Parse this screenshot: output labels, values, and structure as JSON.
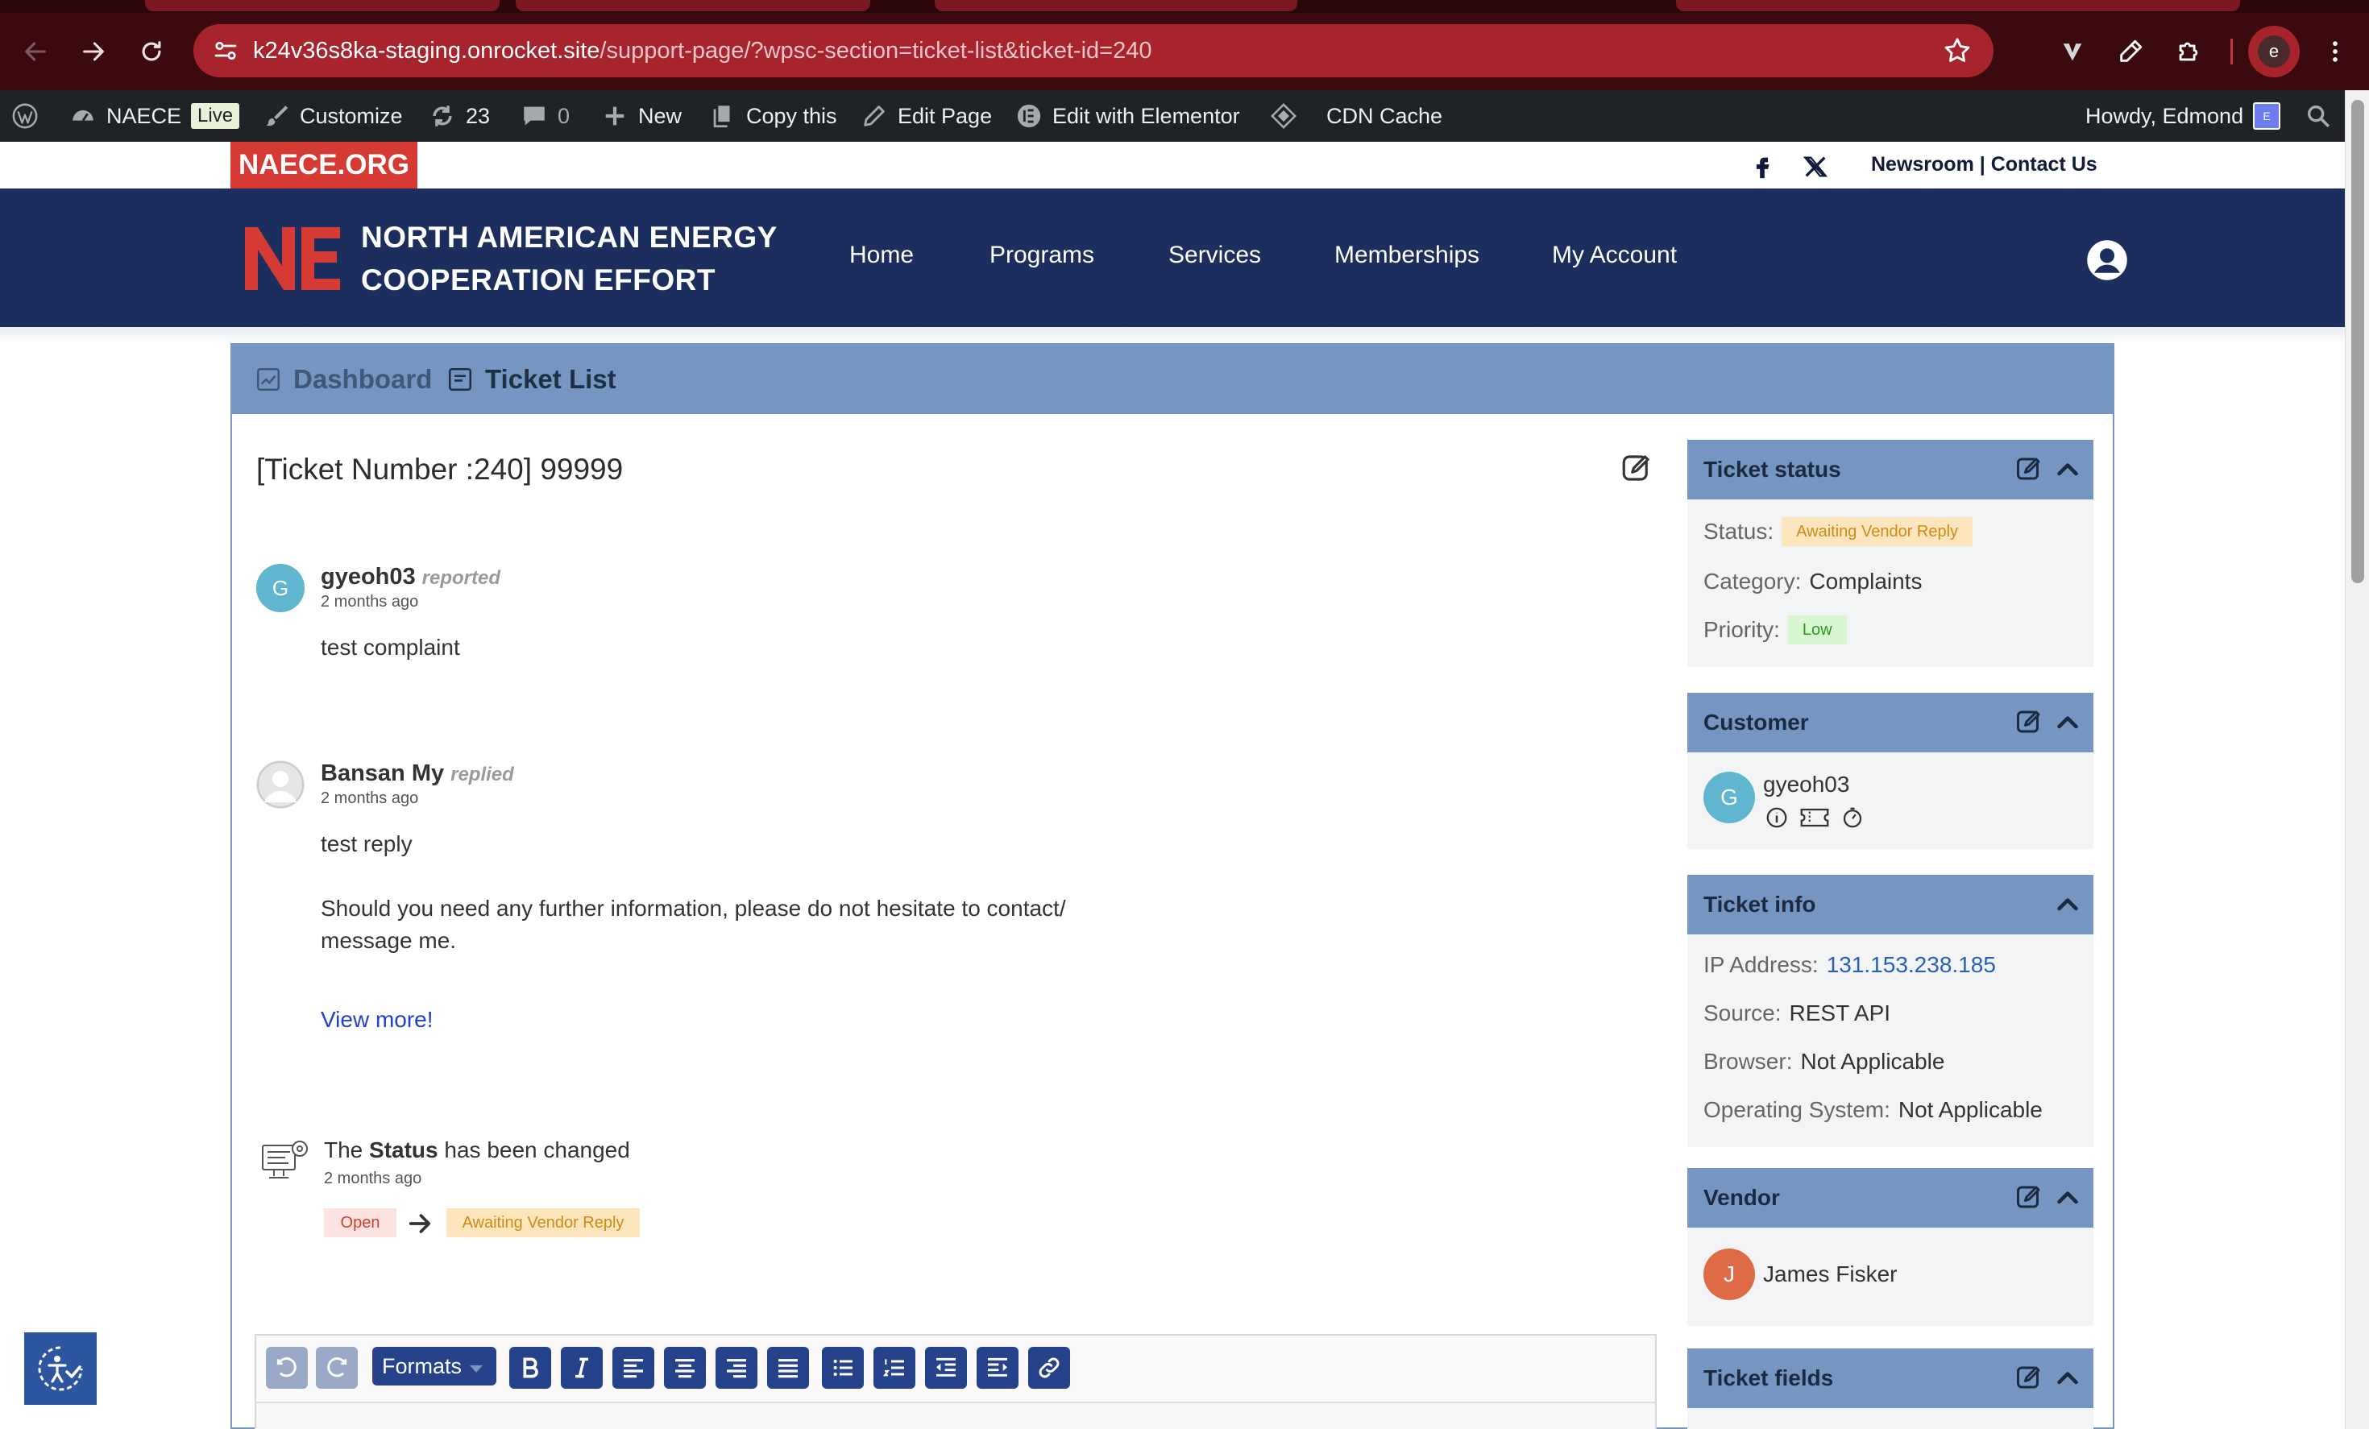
{
  "browser": {
    "url_host": "k24v36s8ka-staging.onrocket.site",
    "url_path": "/support-page/?wpsc-section=ticket-list&ticket-id=240",
    "profile_initial": "e"
  },
  "wp_admin_bar": {
    "site_name": "NAECE",
    "live_badge": "Live",
    "customize": "Customize",
    "updates_count": "23",
    "comments_count": "0",
    "new": "New",
    "copy_this": "Copy this",
    "edit_page": "Edit Page",
    "edit_with_elementor": "Edit with Elementor",
    "cdn_cache": "CDN Cache",
    "howdy": "Howdy, Edmond",
    "avatar_initial": "E"
  },
  "site": {
    "tag": "NAECE.ORG",
    "top_links": "Newsroom | Contact Us",
    "org_name_line1": "NORTH AMERICAN ENERGY",
    "org_name_line2": "COOPERATION EFFORT",
    "nav": [
      "Home",
      "Programs",
      "Services",
      "Memberships",
      "My Account"
    ]
  },
  "support": {
    "tabs": {
      "dashboard": "Dashboard",
      "ticket_list": "Ticket List"
    },
    "ticket_title": "[Ticket Number :240] 99999",
    "threads": [
      {
        "avatar_initial": "G",
        "author": "gyeoh03",
        "verb": "reported",
        "time": "2 months ago",
        "body": [
          "test complaint"
        ]
      },
      {
        "avatar_initial": "",
        "author": "Bansan My",
        "verb": "replied",
        "time": "2 months ago",
        "body": [
          "test reply",
          "Should you need any further information, please do not hesitate to contact/",
          "message me."
        ],
        "view_more": "View more!"
      }
    ],
    "log": {
      "prefix": "The",
      "field": "Status",
      "suffix": "has been changed",
      "time": "2 months ago",
      "from": "Open",
      "to": "Awaiting Vendor Reply"
    },
    "editor": {
      "formats_label": "Formats"
    }
  },
  "sidebar": {
    "ticket_status": {
      "title": "Ticket status",
      "status_label": "Status:",
      "status_value": "Awaiting Vendor Reply",
      "category_label": "Category:",
      "category_value": "Complaints",
      "priority_label": "Priority:",
      "priority_value": "Low"
    },
    "customer": {
      "title": "Customer",
      "avatar_initial": "G",
      "name": "gyeoh03"
    },
    "ticket_info": {
      "title": "Ticket info",
      "ip_label": "IP Address:",
      "ip_value": "131.153.238.185",
      "source_label": "Source:",
      "source_value": "REST API",
      "browser_label": "Browser:",
      "browser_value": "Not Applicable",
      "os_label": "Operating System:",
      "os_value": "Not Applicable"
    },
    "vendor": {
      "title": "Vendor",
      "avatar_initial": "J",
      "name": "James Fisker"
    },
    "ticket_fields": {
      "title": "Ticket fields"
    }
  },
  "colors": {
    "header_navy": "#1c2e5e",
    "accent_red": "#d53a34",
    "panel_blue": "#7496c0",
    "wp_bar": "#1d2327"
  }
}
